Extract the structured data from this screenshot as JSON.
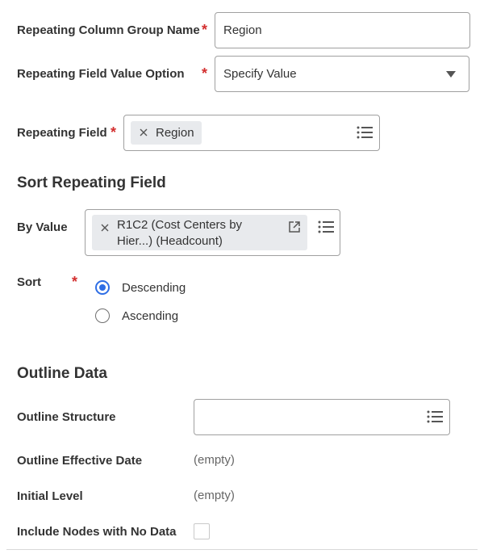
{
  "fields": {
    "repeating_column_group_name": {
      "label": "Repeating Column Group Name",
      "value": "Region",
      "required": "*"
    },
    "repeating_field_value_option": {
      "label": "Repeating Field Value Option",
      "value": "Specify Value",
      "required": "*"
    },
    "repeating_field": {
      "label": "Repeating Field",
      "tag": "Region",
      "required": "*"
    }
  },
  "sort_section": {
    "heading": "Sort Repeating Field",
    "by_value": {
      "label": "By Value",
      "tag_line1": "R1C2 (Cost Centers by",
      "tag_line2": "Hier...) (Headcount)"
    },
    "sort": {
      "label": "Sort",
      "required": "*",
      "options": [
        {
          "label": "Descending",
          "selected": true
        },
        {
          "label": "Ascending",
          "selected": false
        }
      ]
    }
  },
  "outline_section": {
    "heading": "Outline Data",
    "outline_structure": {
      "label": "Outline Structure",
      "value": ""
    },
    "outline_effective_date": {
      "label": "Outline Effective Date",
      "value": "(empty)"
    },
    "initial_level": {
      "label": "Initial Level",
      "value": "(empty)"
    },
    "include_nodes": {
      "label": "Include Nodes with No Data",
      "checked": false
    }
  },
  "colors": {
    "required": "#d32f2f",
    "radio_selected": "#2f6ee5",
    "tag_bg": "#e8eaed"
  },
  "icons": [
    "remove-icon",
    "list-prompt-icon",
    "dropdown-arrow-icon",
    "open-related-icon"
  ]
}
